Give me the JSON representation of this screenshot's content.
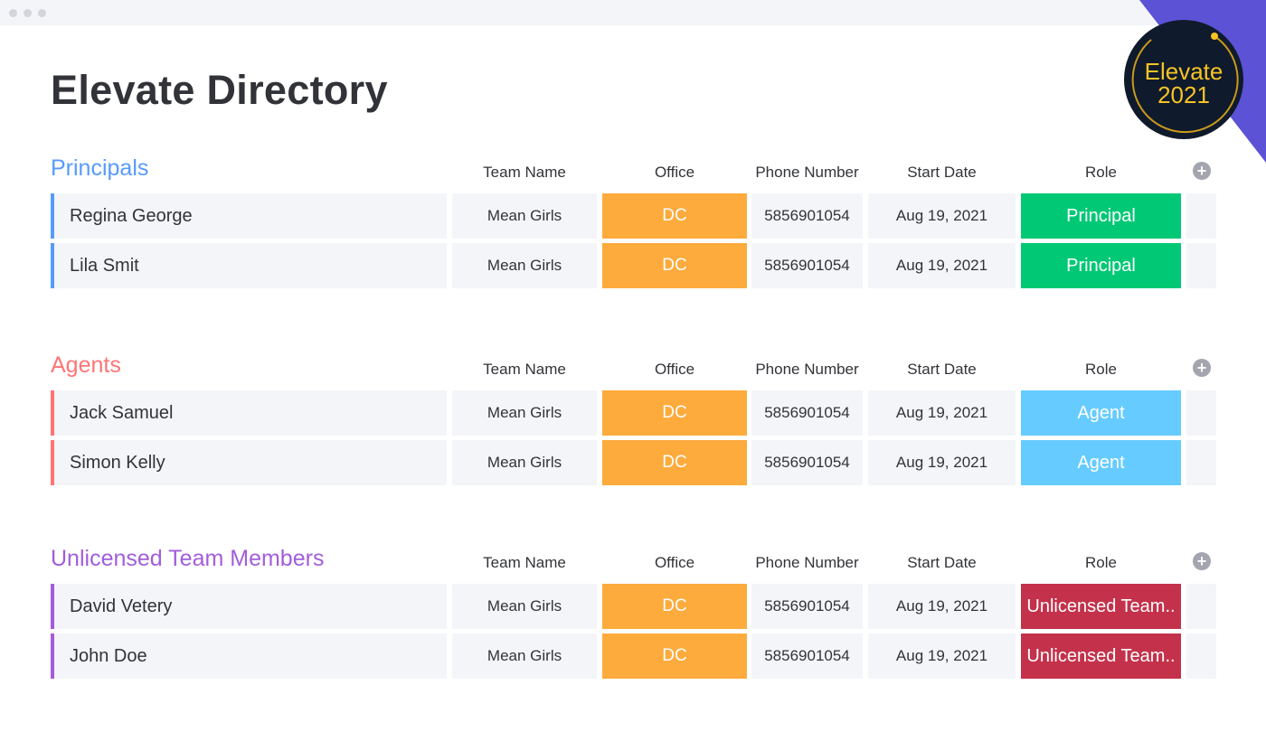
{
  "page": {
    "title": "Elevate Directory"
  },
  "badge": {
    "line1": "Elevate",
    "line2": "2021"
  },
  "colors": {
    "accent_purple": "#5b52d6",
    "office": "#fdab3d",
    "principal": "#00c875",
    "agent": "#66ccff",
    "unlicensed": "#c4314b"
  },
  "columns": [
    "Team Name",
    "Office",
    "Phone Number",
    "Start Date",
    "Role"
  ],
  "groups": [
    {
      "title": "Principals",
      "color": "#579bfc",
      "rows": [
        {
          "name": "Regina George",
          "team": "Mean Girls",
          "office": "DC",
          "phone": "5856901054",
          "start": "Aug 19, 2021",
          "role": "Principal",
          "role_color": "#00c875"
        },
        {
          "name": "Lila Smit",
          "team": "Mean Girls",
          "office": "DC",
          "phone": "5856901054",
          "start": "Aug 19, 2021",
          "role": "Principal",
          "role_color": "#00c875"
        }
      ]
    },
    {
      "title": "Agents",
      "color": "#ff7575",
      "rows": [
        {
          "name": "Jack Samuel",
          "team": "Mean Girls",
          "office": "DC",
          "phone": "5856901054",
          "start": "Aug 19, 2021",
          "role": "Agent",
          "role_color": "#66ccff"
        },
        {
          "name": "Simon Kelly",
          "team": "Mean Girls",
          "office": "DC",
          "phone": "5856901054",
          "start": "Aug 19, 2021",
          "role": "Agent",
          "role_color": "#66ccff"
        }
      ]
    },
    {
      "title": "Unlicensed Team Members",
      "color": "#a25ddc",
      "rows": [
        {
          "name": "David Vetery",
          "team": "Mean Girls",
          "office": "DC",
          "phone": "5856901054",
          "start": "Aug 19, 2021",
          "role": "Unlicensed Team..",
          "role_color": "#c4314b"
        },
        {
          "name": "John Doe",
          "team": "Mean Girls",
          "office": "DC",
          "phone": "5856901054",
          "start": "Aug 19, 2021",
          "role": "Unlicensed Team..",
          "role_color": "#c4314b"
        }
      ]
    }
  ]
}
